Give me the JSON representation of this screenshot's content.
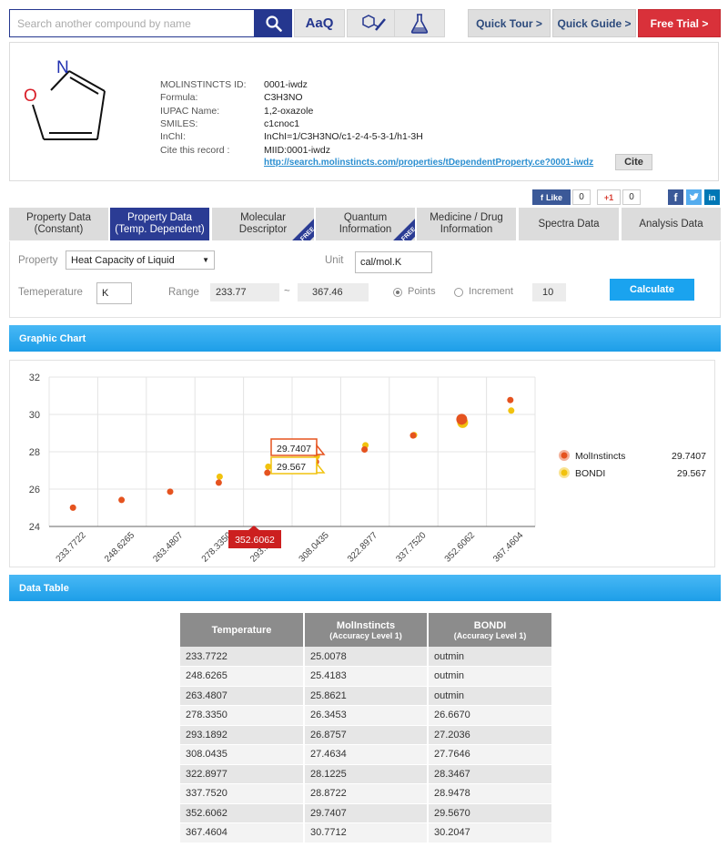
{
  "search": {
    "placeholder": "Search another compound by name"
  },
  "toolbar": {
    "text_search_label": "AaQ"
  },
  "nav": {
    "quick_tour": "Quick Tour >",
    "quick_guide": "Quick Guide >",
    "free_trial": "Free Trial >"
  },
  "compound": {
    "fields": [
      {
        "key": "MOLINSTINCTS ID:",
        "value": "0001-iwdz"
      },
      {
        "key": "Formula:",
        "value": "C3H3NO"
      },
      {
        "key": "IUPAC Name:",
        "value": "1,2-oxazole"
      },
      {
        "key": "SMILES:",
        "value": "c1cnoc1"
      },
      {
        "key": "InChI:",
        "value": "InChI=1/C3H3NO/c1-2-4-5-3-1/h1-3H"
      },
      {
        "key": "Cite this record :",
        "value": "MIID:0001-iwdz"
      }
    ],
    "cite_url": "http://search.molinstincts.com/properties/tDependentProperty.ce?0001-iwdz",
    "cite_button": "Cite",
    "atom_o": "O",
    "atom_n": "N"
  },
  "social": {
    "like": "Like",
    "like_count": "0",
    "gplus": "+1",
    "gplus_count": "0"
  },
  "tabs": [
    {
      "label": "Property Data\n(Constant)",
      "active": false,
      "free": false
    },
    {
      "label": "Property Data\n(Temp. Dependent)",
      "active": true,
      "free": false
    },
    {
      "label": "Molecular\nDescriptor",
      "active": false,
      "free": true
    },
    {
      "label": "Quantum\nInformation",
      "active": false,
      "free": true
    },
    {
      "label": "Medicine / Drug\nInformation",
      "active": false,
      "free": false
    },
    {
      "label": "Spectra Data",
      "active": false,
      "free": false
    },
    {
      "label": "Analysis Data",
      "active": false,
      "free": false
    }
  ],
  "free_badge": "FREE",
  "form": {
    "property_label": "Property",
    "property_value": "Heat Capacity of Liquid",
    "unit_label": "Unit",
    "unit_value": "cal/mol.K",
    "temperature_label": "Temeperature",
    "temperature_value": "K",
    "range_label": "Range",
    "range_min": "233.77",
    "range_sep": "~",
    "range_max": "367.46",
    "points_label": "Points",
    "increment_label": "Increment",
    "count_value": "10",
    "calculate_label": "Calculate"
  },
  "sections": {
    "chart": "Graphic Chart",
    "table": "Data Table"
  },
  "chart_data": {
    "type": "scatter",
    "x": [
      "233.7722",
      "248.6265",
      "263.4807",
      "278.3350",
      "293.1892",
      "308.0435",
      "322.8977",
      "337.7520",
      "352.6062",
      "367.4604"
    ],
    "ylim": [
      24,
      32
    ],
    "yticks": [
      24,
      26,
      28,
      30,
      32
    ],
    "grid": true,
    "series": [
      {
        "name": "MolInstincts",
        "color": "#e5531f",
        "values": [
          25.0078,
          25.4183,
          25.8621,
          26.3453,
          26.8757,
          27.4634,
          28.1225,
          28.8722,
          29.7407,
          30.7712
        ]
      },
      {
        "name": "BONDI",
        "color": "#f1c20e",
        "values": [
          null,
          null,
          null,
          26.667,
          27.2036,
          27.7646,
          28.3467,
          28.8974,
          29.567,
          30.2047
        ]
      }
    ],
    "hover_index": 8,
    "hover_x_label": "352.6062",
    "tooltips": [
      "29.7407",
      "29.567"
    ],
    "legend": [
      {
        "name": "MolInstincts",
        "value": "29.7407"
      },
      {
        "name": "BONDI",
        "value": "29.567"
      }
    ]
  },
  "table": {
    "headers": [
      {
        "title": "Temperature",
        "sub": ""
      },
      {
        "title": "MolInstincts",
        "sub": "(Accuracy Level 1)"
      },
      {
        "title": "BONDI",
        "sub": "(Accuracy Level 1)"
      }
    ],
    "rows": [
      [
        "233.7722",
        "25.0078",
        "outmin"
      ],
      [
        "248.6265",
        "25.4183",
        "outmin"
      ],
      [
        "263.4807",
        "25.8621",
        "outmin"
      ],
      [
        "278.3350",
        "26.3453",
        "26.6670"
      ],
      [
        "293.1892",
        "26.8757",
        "27.2036"
      ],
      [
        "308.0435",
        "27.4634",
        "27.7646"
      ],
      [
        "322.8977",
        "28.1225",
        "28.3467"
      ],
      [
        "337.7520",
        "28.8722",
        "28.9478"
      ],
      [
        "352.6062",
        "29.7407",
        "29.5670"
      ],
      [
        "367.4604",
        "30.7712",
        "30.2047"
      ]
    ]
  }
}
